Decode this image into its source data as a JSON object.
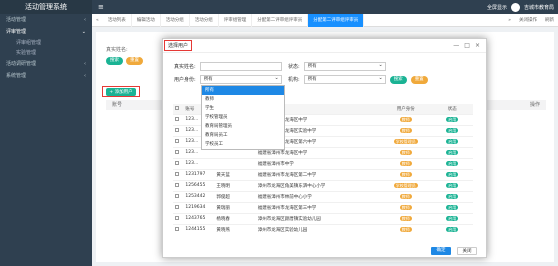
{
  "app_title": "活动管理系统",
  "sidebar": {
    "items": [
      {
        "label": "活动管理",
        "expanded": false
      },
      {
        "label": "评审管理",
        "expanded": true,
        "subitems": [
          "评审组管理",
          "实验管理"
        ]
      },
      {
        "label": "活动调研管理"
      },
      {
        "label": "系统管理"
      }
    ]
  },
  "topbar": {
    "fullscreen_label": "全屏显示",
    "user_name": "吉城市教育局"
  },
  "tabs": {
    "items": [
      "活动列表",
      "编辑活动",
      "活动分组",
      "活动分组",
      "评审组管理",
      "分配第二评审组评审员",
      "分配第二评审组评审员"
    ],
    "active_index": 6,
    "close_label": "关闭操作",
    "refresh_label": "刷新"
  },
  "background": {
    "form_label": "真实姓名:",
    "search_label": "搜索",
    "reset_label": "重置",
    "add_button_label": "+ 添加用户",
    "col_left": "账号",
    "col_right": "操作"
  },
  "modal": {
    "title": "选择用户",
    "fields": {
      "real_name_label": "真实姓名:",
      "status_label": "状态:",
      "status_value": "所有",
      "identity_label": "用户身份:",
      "identity_value": "所有",
      "org_label": "机构:",
      "org_value": "所有",
      "search_label": "搜索",
      "reset_label": "重置"
    },
    "dropdown_options": [
      "所有",
      "教师",
      "学生",
      "学校管理员",
      "教育局管理员",
      "教育局员工",
      "学校员工"
    ],
    "table": {
      "headers": [
        "",
        "账号",
        "真实姓名",
        "机构名称",
        "用户身份",
        "状态"
      ],
      "rows": [
        {
          "account": "123...",
          "name": "",
          "org": "福建省漳州市龙海区中学",
          "identity": "教师",
          "status": "启用"
        },
        {
          "account": "123...",
          "name": "",
          "org": "福建省漳州市龙海区实验中学",
          "identity": "教师",
          "status": "启用"
        },
        {
          "account": "123...",
          "name": "",
          "org": "福建省漳州市龙海区第六中学",
          "identity": "学校管理员",
          "status": "启用"
        },
        {
          "account": "123...",
          "name": "",
          "org": "福建省漳州市龙海区中学",
          "identity": "教师",
          "status": "启用"
        },
        {
          "account": "123...",
          "name": "",
          "org": "福建省漳州市中学",
          "identity": "教师",
          "status": "启用"
        },
        {
          "account": "1231797",
          "name": "黄天蓝",
          "org": "福建省漳州市龙海区第二中学",
          "identity": "教师",
          "status": "启用"
        },
        {
          "account": "1256455",
          "name": "王晓明",
          "org": "漳州市龙海区角美镇东泗中心小学",
          "identity": "学校管理员",
          "status": "启用"
        },
        {
          "account": "1253442",
          "name": "郭俊超",
          "org": "福建省漳州市林前中心小学",
          "identity": "教师",
          "status": "启用"
        },
        {
          "account": "1219634",
          "name": "黄瑞丽",
          "org": "福建省漳州市龙海区第三中学",
          "identity": "教师",
          "status": "启用"
        },
        {
          "account": "1243765",
          "name": "杨晓春",
          "org": "漳州市龙海区颜厝镇实验幼儿园",
          "identity": "教师",
          "status": "启用"
        },
        {
          "account": "1244155",
          "name": "黄晓燕",
          "org": "漳州市龙海区实验幼儿园",
          "identity": "教师",
          "status": "启用"
        }
      ]
    },
    "ok_label": "确定",
    "cancel_label": "关闭"
  },
  "colors": {
    "sidebar": "#2f4050",
    "accent": "#1e88e5",
    "green": "#1ab394",
    "orange": "#f0a93b",
    "highlight": "#e53935"
  }
}
